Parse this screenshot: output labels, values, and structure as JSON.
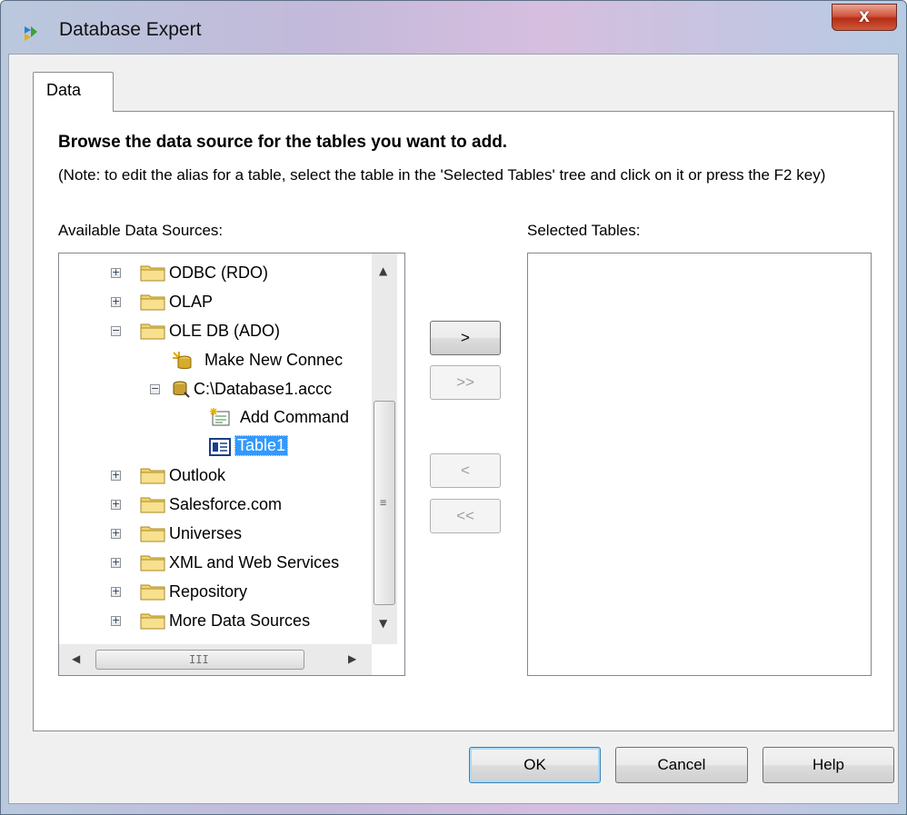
{
  "window": {
    "title": "Database Expert",
    "close_label": "x"
  },
  "tab": {
    "label": "Data"
  },
  "heading": "Browse the data source for the tables you want to add.",
  "note": "(Note: to edit the alias for a table, select the table in the 'Selected Tables' tree and click on it or press the F2 key)",
  "available_label": "Available Data Sources:",
  "selected_label": "Selected Tables:",
  "tree": {
    "items": [
      {
        "label": "ODBC (RDO)"
      },
      {
        "label": "OLAP"
      },
      {
        "label": "OLE DB (ADO)"
      },
      {
        "label": "Make New Connec"
      },
      {
        "label": "C:\\Database1.accc"
      },
      {
        "label": "Add Command"
      },
      {
        "label": "Table1"
      },
      {
        "label": "Outlook"
      },
      {
        "label": "Salesforce.com"
      },
      {
        "label": "Universes"
      },
      {
        "label": "XML and Web Services"
      },
      {
        "label": "Repository"
      },
      {
        "label": "More Data Sources"
      }
    ],
    "expander_plus": "+",
    "expander_minus": "−"
  },
  "scroll": {
    "up": "▲",
    "down": "▼",
    "left": "◀",
    "right": "▶",
    "vgrip": "≡",
    "hgrip": "III"
  },
  "transfer": {
    "add": ">",
    "add_all": ">>",
    "remove": "<",
    "remove_all": "<<"
  },
  "footer": {
    "ok": "OK",
    "cancel": "Cancel",
    "help": "Help"
  },
  "colors": {
    "selection": "#3399ff",
    "close_button": "#c9462b"
  }
}
